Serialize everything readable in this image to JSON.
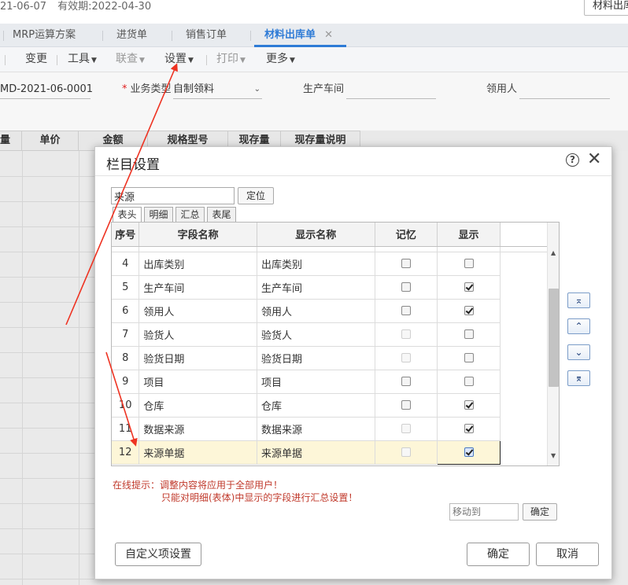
{
  "header": {
    "date_text": "21-06-07",
    "validity_text": "有效期:2022-04-30",
    "right_button": "材料出库"
  },
  "tabs": [
    {
      "label": "MRP运算方案"
    },
    {
      "label": "进货单"
    },
    {
      "label": "销售订单"
    },
    {
      "label": "材料出库单",
      "active": true
    }
  ],
  "tab_close_glyph": "✕",
  "toolbar": {
    "change": "变更",
    "tools": "工具",
    "query": "联查",
    "settings": "设置",
    "print": "打印",
    "more": "更多"
  },
  "form": {
    "doc_no": "MD-2021-06-0001",
    "biz_type_label": "业务类型",
    "biz_type_value": "自制领料",
    "workshop_label": "生产车间",
    "receiver_label": "领用人"
  },
  "grid_headers": [
    "量",
    "单价",
    "金额",
    "规格型号",
    "现存量",
    "现存量说明"
  ],
  "dialog": {
    "title": "栏目设置",
    "search_value": "来源",
    "locate_button": "定位",
    "subtabs": [
      "表头",
      "明细",
      "汇总",
      "表尾"
    ],
    "columns": [
      "序号",
      "字段名称",
      "显示名称",
      "记忆",
      "显示"
    ],
    "rows": [
      {
        "no": "4",
        "field": "出库类别",
        "display": "出库类别",
        "memory": false,
        "memory_disabled": false,
        "show": false
      },
      {
        "no": "5",
        "field": "生产车间",
        "display": "生产车间",
        "memory": false,
        "memory_disabled": false,
        "show": true
      },
      {
        "no": "6",
        "field": "领用人",
        "display": "领用人",
        "memory": false,
        "memory_disabled": false,
        "show": true
      },
      {
        "no": "7",
        "field": "验货人",
        "display": "验货人",
        "memory": false,
        "memory_disabled": true,
        "show": false
      },
      {
        "no": "8",
        "field": "验货日期",
        "display": "验货日期",
        "memory": false,
        "memory_disabled": true,
        "show": false
      },
      {
        "no": "9",
        "field": "项目",
        "display": "项目",
        "memory": false,
        "memory_disabled": false,
        "show": false
      },
      {
        "no": "10",
        "field": "仓库",
        "display": "仓库",
        "memory": false,
        "memory_disabled": false,
        "show": true
      },
      {
        "no": "11",
        "field": "数据来源",
        "display": "数据来源",
        "memory": false,
        "memory_disabled": true,
        "show": true
      },
      {
        "no": "12",
        "field": "来源单据",
        "display": "来源单据",
        "memory": false,
        "memory_disabled": true,
        "show": true,
        "selected": true
      }
    ],
    "move_buttons": {
      "top": "⌅",
      "up": "⌃",
      "down": "⌄",
      "bottom": "⌆"
    },
    "hint_line1": "在线提示：调整内容将应用于全部用户！",
    "hint_line2": "只能对明细(表体)中显示的字段进行汇总设置！",
    "moveto_placeholder": "移动到",
    "moveto_ok": "确定",
    "custom_button": "自定义项设置",
    "ok_button": "确定",
    "cancel_button": "取消"
  },
  "accent_color": "#2e7bd6",
  "annotation_color": "#ee3322"
}
